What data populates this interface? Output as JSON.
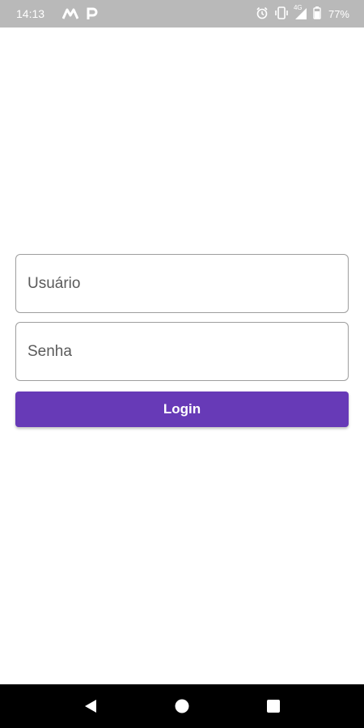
{
  "status_bar": {
    "time": "14:13",
    "network": "4G",
    "battery": "77%",
    "icons": [
      "m-app-icon",
      "p-app-icon",
      "alarm-icon",
      "vibrate-icon",
      "signal-icon",
      "battery-icon"
    ],
    "color": "#b9b9b9"
  },
  "form": {
    "username_placeholder": "Usuário",
    "password_placeholder": "Senha",
    "login_label": "Login",
    "accent_color": "#673ab7"
  },
  "nav_bar": {
    "icons": [
      "back-icon",
      "home-icon",
      "recents-icon"
    ]
  }
}
